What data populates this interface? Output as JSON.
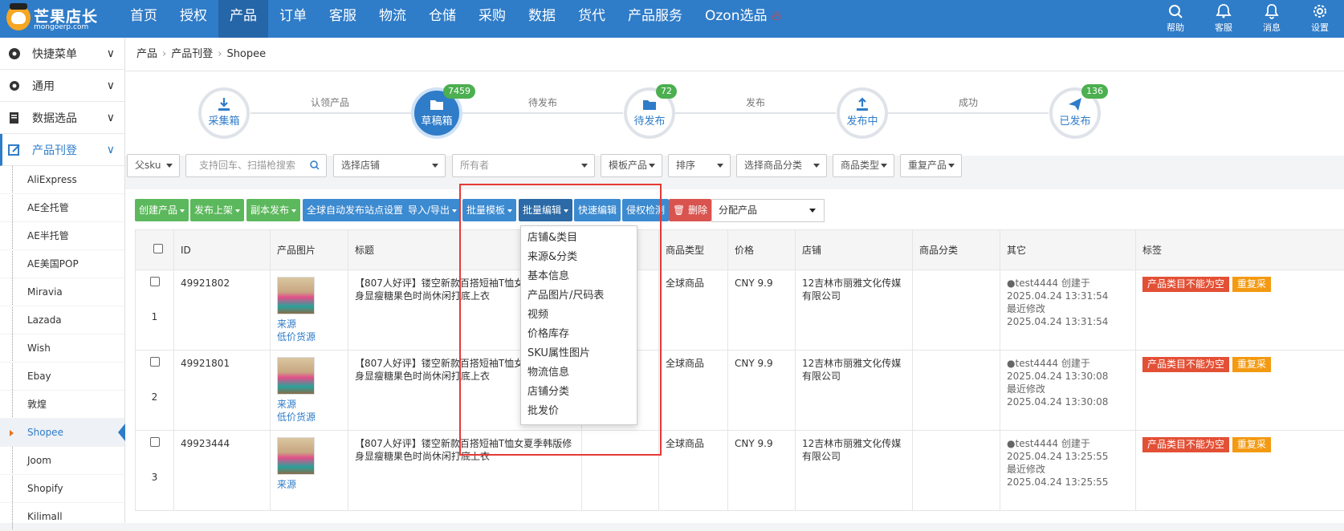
{
  "logo": {
    "name": "芒果店长",
    "url": "mongoerp.com"
  },
  "nav": [
    "首页",
    "授权",
    "产品",
    "订单",
    "客服",
    "物流",
    "仓储",
    "采购",
    "数据",
    "货代",
    "产品服务",
    "Ozon选品"
  ],
  "nav_active": 2,
  "tools": [
    {
      "label": "帮助",
      "icon": "search-icon"
    },
    {
      "label": "客服",
      "icon": "support-icon"
    },
    {
      "label": "消息",
      "icon": "bell-icon"
    },
    {
      "label": "设置",
      "icon": "gear-icon"
    }
  ],
  "sidebar": {
    "groups": [
      "快捷菜单",
      "通用",
      "数据选品",
      "产品刊登"
    ],
    "items": [
      "AliExpress",
      "AE全托管",
      "AE半托管",
      "AE美国POP",
      "Miravia",
      "Lazada",
      "Wish",
      "Ebay",
      "敦煌",
      "Shopee",
      "Joom",
      "Shopify",
      "Kilimall"
    ],
    "active_item": "Shopee"
  },
  "breadcrumb": [
    "产品",
    "产品刊登",
    "Shopee"
  ],
  "flow": {
    "steps": [
      {
        "label": "采集箱",
        "badge": ""
      },
      {
        "label": "草稿箱",
        "badge": "7459"
      },
      {
        "label": "待发布",
        "badge": "72"
      },
      {
        "label": "发布中",
        "badge": ""
      },
      {
        "label": "已发布",
        "badge": "136"
      }
    ],
    "links": [
      "认领产品",
      "待发布",
      "发布",
      "成功"
    ]
  },
  "filters": {
    "parent_sku": "父sku",
    "search_placeholder": "支持回车、扫描枪搜索",
    "store": "选择店铺",
    "owner": "所有者",
    "template": "模板产品",
    "sort": "排序",
    "category": "选择商品分类",
    "product_type": "商品类型",
    "duplicate": "重复产品"
  },
  "toolbar": {
    "create": "创建产品",
    "publish": "发布上架",
    "copy": "副本发布",
    "auto_site": "全球自动发布站点设置",
    "import_export": "导入/导出",
    "batch_template": "批量模板",
    "batch_edit": "批量编辑",
    "quick_edit": "快速编辑",
    "infringe": "侵权检测",
    "delete": "删除",
    "assign": "分配产品"
  },
  "dropdown": [
    "店铺&类目",
    "来源&分类",
    "基本信息",
    "产品图片/尺码表",
    "视频",
    "价格库存",
    "SKU属性图片",
    "物流信息",
    "店铺分类",
    "批发价"
  ],
  "table": {
    "headers": [
      "ID",
      "产品图片",
      "标题",
      "号",
      "商品类型",
      "价格",
      "店铺",
      "商品分类",
      "其它",
      "标签"
    ],
    "rows": [
      {
        "num": "1",
        "id": "49921802",
        "src": "来源",
        "src2": "低价货源",
        "title": "【807人好评】镂空新款百搭短袖T恤女夏季韩版修身显瘦糖果色时尚休闲打底上衣",
        "type": "全球商品",
        "price": "CNY 9.9",
        "store": "12吉林市丽雅文化传媒有限公司",
        "creator": "test4444 创建于",
        "created": "2025.04.24 13:31:54",
        "mod_label": "最近修改",
        "modified": "2025.04.24 13:31:54",
        "tag1": "产品类目不能为空",
        "tag2": "重复采"
      },
      {
        "num": "2",
        "id": "49921801",
        "src": "来源",
        "src2": "低价货源",
        "title": "【807人好评】镂空新款百搭短袖T恤女夏季韩版修身显瘦糖果色时尚休闲打底上衣",
        "type": "全球商品",
        "price": "CNY 9.9",
        "store": "12吉林市丽雅文化传媒有限公司",
        "creator": "test4444 创建于",
        "created": "2025.04.24 13:30:08",
        "mod_label": "最近修改",
        "modified": "2025.04.24 13:30:08",
        "tag1": "产品类目不能为空",
        "tag2": "重复采"
      },
      {
        "num": "3",
        "id": "49923444",
        "src": "来源",
        "src2": "",
        "title": "【807人好评】镂空新款百搭短袖T恤女夏季韩版修身显瘦糖果色时尚休闲打底上衣",
        "type": "全球商品",
        "price": "CNY 9.9",
        "store": "12吉林市丽雅文化传媒有限公司",
        "creator": "test4444 创建于",
        "created": "2025.04.24 13:25:55",
        "mod_label": "最近修改",
        "modified": "2025.04.24 13:25:55",
        "tag1": "产品类目不能为空",
        "tag2": "重复采"
      }
    ]
  }
}
